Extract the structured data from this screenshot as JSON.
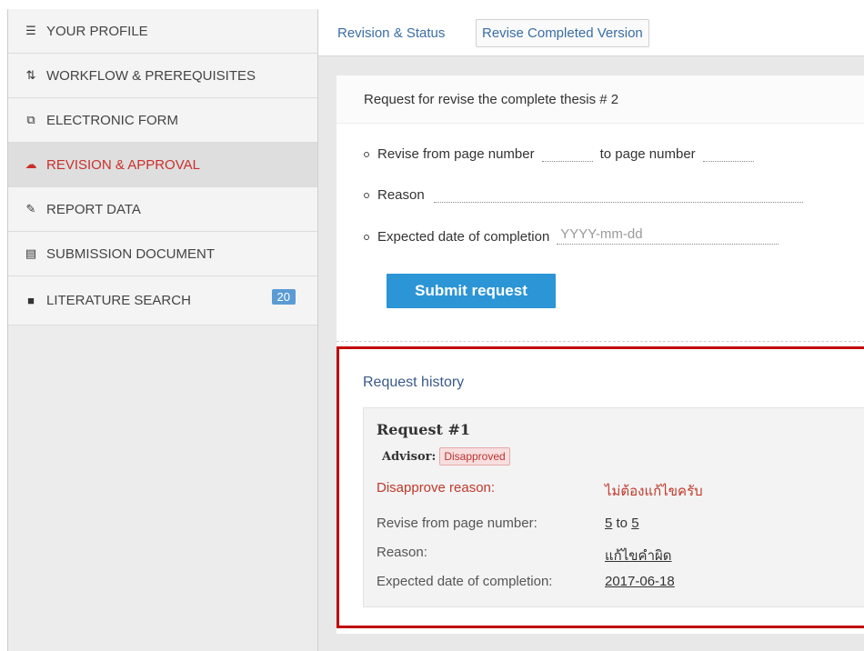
{
  "sidebar": {
    "items": [
      {
        "label": "YOUR PROFILE",
        "icon": "list-icon",
        "glyph": "☰"
      },
      {
        "label": "WORKFLOW & PREREQUISITES",
        "icon": "sort-icon",
        "glyph": "⇅"
      },
      {
        "label": "ELECTRONIC FORM",
        "icon": "copy-icon",
        "glyph": "⧉"
      },
      {
        "label": "REVISION & APPROVAL",
        "icon": "cloud-upload-icon",
        "glyph": "☁"
      },
      {
        "label": "REPORT DATA",
        "icon": "edit-icon",
        "glyph": "✎"
      },
      {
        "label": "SUBMISSION DOCUMENT",
        "icon": "file-icon",
        "glyph": "▤"
      },
      {
        "label": "LITERATURE SEARCH",
        "icon": "book-icon",
        "glyph": "■",
        "badge": "20"
      }
    ],
    "active_color": "#c9302c"
  },
  "tabs": {
    "status": "Revision & Status",
    "revise": "Revise Completed Version"
  },
  "form": {
    "title": "Request for revise the complete thesis # 2",
    "revise_from_label": "Revise from page number",
    "to_label": "to page number",
    "reason_label": "Reason",
    "date_label": "Expected date of completion",
    "date_placeholder": "YYYY-mm-dd",
    "submit_label": "Submit request"
  },
  "history": {
    "title": "Request history",
    "request": {
      "heading": "Request #1",
      "advisor_label": "Advisor:",
      "advisor_status": "Disapproved",
      "disapprove_label": "Disapprove reason:",
      "disapprove_value": "ไม่ต้องแก้ไขครับ",
      "pages_label": "Revise from page number:",
      "page_from": "5",
      "to_word": "to",
      "page_to": "5",
      "reason_label": "Reason:",
      "reason_value": "แก้ไขคำผิด",
      "date_label": "Expected date of completion:",
      "date_value": "2017-06-18"
    }
  },
  "colors": {
    "accent": "#2b95d6",
    "highlight_border": "#c00000",
    "link": "#3a6ea5"
  }
}
